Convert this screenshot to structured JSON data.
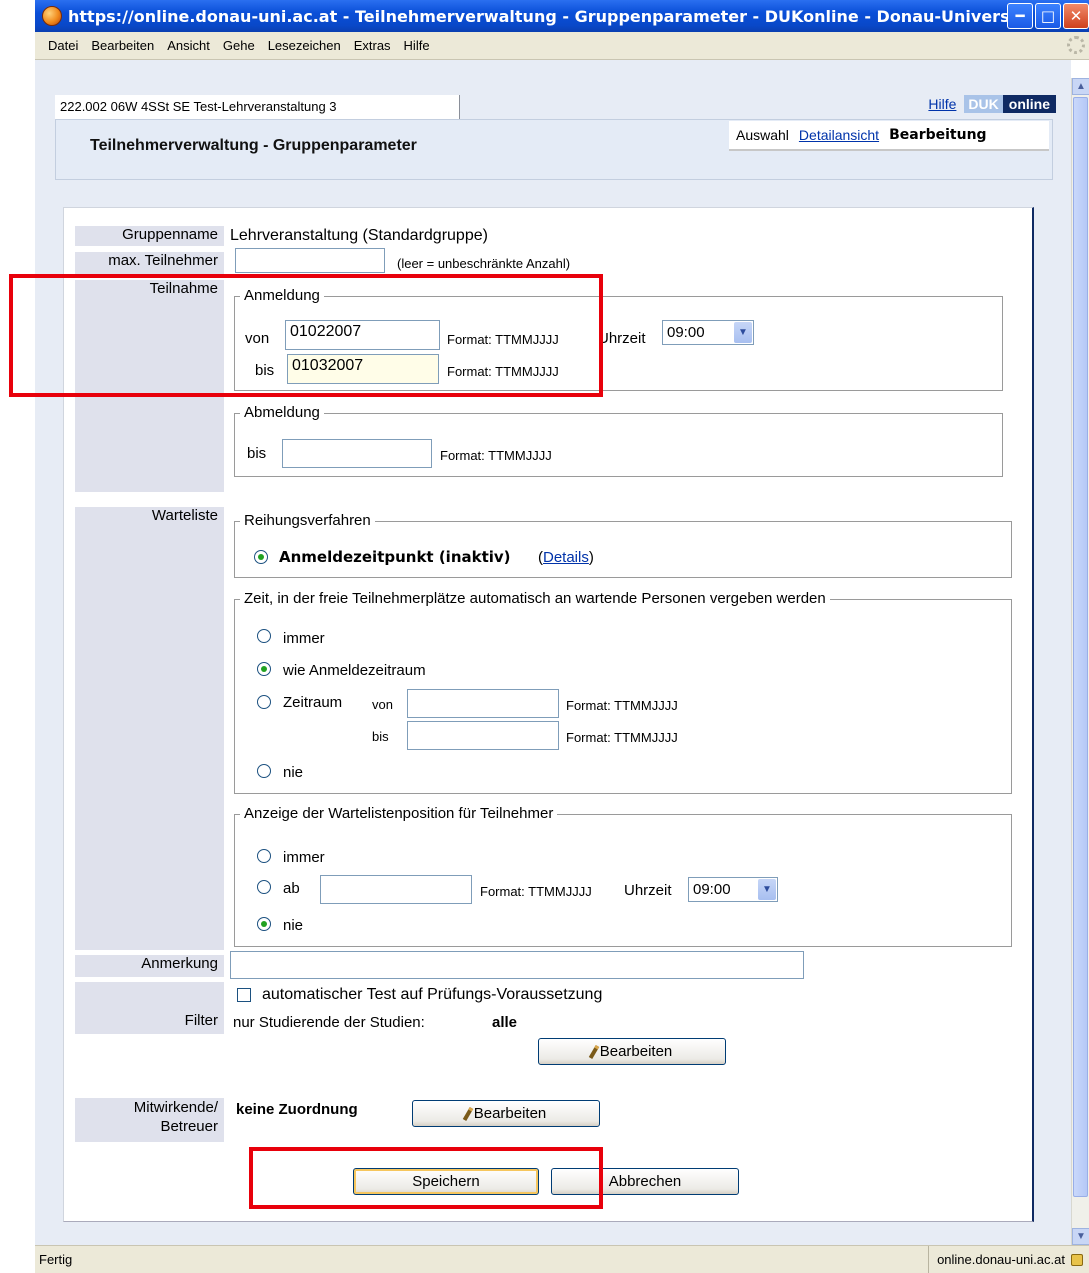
{
  "window": {
    "title": "https://online.donau-uni.ac.at - Teilnehmerverwaltung - Gruppenparameter - DUKonline - Donau-Universitä...",
    "menu": [
      "Datei",
      "Bearbeiten",
      "Ansicht",
      "Gehe",
      "Lesezeichen",
      "Extras",
      "Hilfe"
    ],
    "status": "Fertig",
    "status_host": "online.donau-uni.ac.at"
  },
  "header": {
    "course": "222.002 06W 4SSt SE Test-Lehrveranstaltung 3",
    "help": "Hilfe",
    "logo_a": "DUK",
    "logo_b": "online",
    "title": "Teilnehmerverwaltung - Gruppenparameter",
    "nav": {
      "auswahl": "Auswahl",
      "detail": "Detailansicht",
      "bearbeitung": "Bearbeitung"
    }
  },
  "form": {
    "gruppenname_label": "Gruppenname",
    "gruppenname_value": "Lehrveranstaltung (Standardgruppe)",
    "max_label": "max. Teilnehmer",
    "max_value": "",
    "max_hint": "(leer = unbeschränkte Anzahl)",
    "teilnahme_label": "Teilnahme",
    "anmeldung": {
      "legend": "Anmeldung",
      "von_label": "von",
      "von_value": "01022007",
      "bis_label": "bis",
      "bis_value": "01032007",
      "format": "Format: TTMMJJJJ",
      "uhrzeit_label": "Uhrzeit",
      "uhrzeit_value": "09:00"
    },
    "abmeldung": {
      "legend": "Abmeldung",
      "bis_label": "bis",
      "bis_value": "",
      "format": "Format: TTMMJJJJ"
    },
    "warteliste_label": "Warteliste",
    "reihung": {
      "legend": "Reihungsverfahren",
      "option": "Anmeldezeitpunkt (inaktiv)",
      "paren_open": "(",
      "details": "Details",
      "paren_close": ")"
    },
    "zeit": {
      "legend": "Zeit, in der freie Teilnehmerplätze automatisch an wartende Personen vergeben werden",
      "immer": "immer",
      "wie": "wie Anmeldezeitraum",
      "zeitraum": "Zeitraum",
      "von": "von",
      "bis": "bis",
      "format": "Format: TTMMJJJJ",
      "nie": "nie",
      "selected": "wie"
    },
    "anzeige": {
      "legend": "Anzeige der Wartelistenposition für Teilnehmer",
      "immer": "immer",
      "ab": "ab",
      "format": "Format: TTMMJJJJ",
      "uhrzeit_label": "Uhrzeit",
      "uhrzeit_value": "09:00",
      "nie": "nie",
      "selected": "nie"
    },
    "anmerkung_label": "Anmerkung",
    "anmerkung_value": "",
    "auto_test": "automatischer Test auf Prüfungs-Voraussetzung",
    "filter_label": "Filter",
    "filter_text": "nur Studierende der Studien:",
    "filter_value": "alle",
    "bearbeiten": "Bearbeiten",
    "mitwirkende_label_1": "Mitwirkende/",
    "mitwirkende_label_2": "Betreuer",
    "mitwirkende_value": "keine Zuordnung",
    "save": "Speichern",
    "cancel": "Abbrechen"
  },
  "colors": {
    "highlight_box": "#e8000b",
    "label_bg": "#dfe1ec",
    "accent": "#0f2a63"
  }
}
